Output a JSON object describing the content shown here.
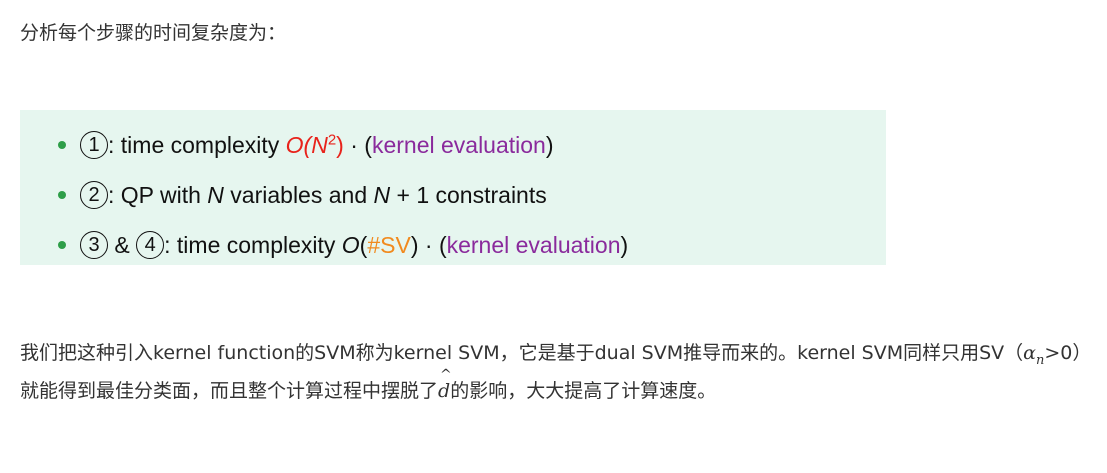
{
  "intro_text": "分析每个步骤的时间复杂度为：",
  "steps": [
    {
      "circle1": "1",
      "text_a": ": time complexity ",
      "complexity_O": "O",
      "complexity_arg": "(N",
      "complexity_sup": "2",
      "complexity_close": ")",
      "dot": " · (",
      "colored": "kernel evaluation",
      "end": ")"
    },
    {
      "circle1": "2",
      "text_a": ": QP with ",
      "var1": "N",
      "text_b": " variables and ",
      "var2": "N",
      "text_c": " + 1 constraints"
    },
    {
      "circle1": "3",
      "amp": " & ",
      "circle2": "4",
      "text_a": ": time complexity ",
      "complexity_O": "O",
      "paren_open": "(",
      "sv": "#SV",
      "paren_close": ")",
      "dot": " · (",
      "colored": "kernel evaluation",
      "end": ")"
    }
  ],
  "final_text": {
    "part1": "我们把这种引入kernel function的SVM称为kernel SVM，它是基于dual SVM推导而来的。kernel SVM同样只用SV（",
    "alpha": "α",
    "sub_n": "n",
    "part2": ">0）就能得到最佳分类面，而且整个计算过程中摆脱了",
    "d": "d",
    "part3": "的影响，大大提高了计算速度。"
  },
  "colors": {
    "box_background": "#e6f6ef",
    "bullet": "#2e9e48",
    "complexity_red": "#e8231b",
    "kernel_purple": "#8a2a9c",
    "sv_orange": "#f18a1e"
  }
}
